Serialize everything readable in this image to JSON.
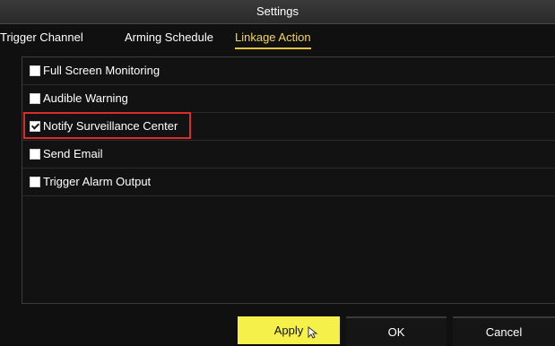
{
  "window": {
    "title": "Settings"
  },
  "tabs": [
    {
      "label": "Trigger Channel",
      "active": false
    },
    {
      "label": "Arming Schedule",
      "active": false
    },
    {
      "label": "Linkage Action",
      "active": true
    }
  ],
  "linkage_options": [
    {
      "label": "Full Screen Monitoring",
      "checked": false
    },
    {
      "label": "Audible Warning",
      "checked": false
    },
    {
      "label": "Notify Surveillance Center",
      "checked": true,
      "highlighted": true
    },
    {
      "label": "Send Email",
      "checked": false
    },
    {
      "label": "Trigger Alarm Output",
      "checked": false
    }
  ],
  "buttons": {
    "apply_label": "Apply",
    "ok_label": "OK",
    "cancel_label": "Cancel"
  },
  "colors": {
    "active_tab": "#f2d65c",
    "apply_button": "#f6f04a",
    "highlight_box": "#d92d2d"
  },
  "icons": {
    "pointer": "mouse-pointer-icon"
  }
}
